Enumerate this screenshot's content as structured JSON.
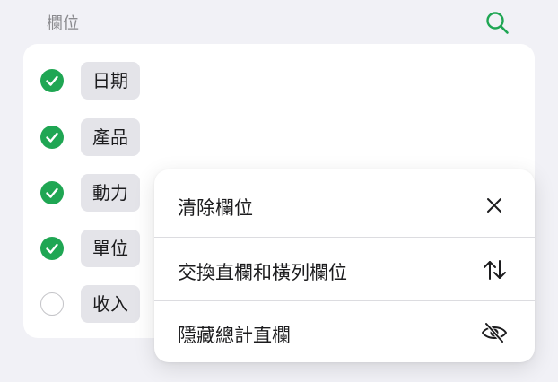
{
  "header": {
    "title": "欄位",
    "search_icon": "search-icon"
  },
  "colors": {
    "accent_green": "#1fa653",
    "background": "#f1f1f6",
    "chip": "#e4e4e9"
  },
  "fields": [
    {
      "label": "日期",
      "checked": true
    },
    {
      "label": "產品",
      "checked": true
    },
    {
      "label": "動力",
      "checked": true
    },
    {
      "label": "單位",
      "checked": true
    },
    {
      "label": "收入",
      "checked": false
    }
  ],
  "menu": {
    "items": [
      {
        "label": "清除欄位",
        "icon": "close-icon"
      },
      {
        "label": "交換直欄和橫列欄位",
        "icon": "swap-arrows-icon"
      },
      {
        "label": "隱藏總計直欄",
        "icon": "eye-slash-icon"
      }
    ]
  }
}
